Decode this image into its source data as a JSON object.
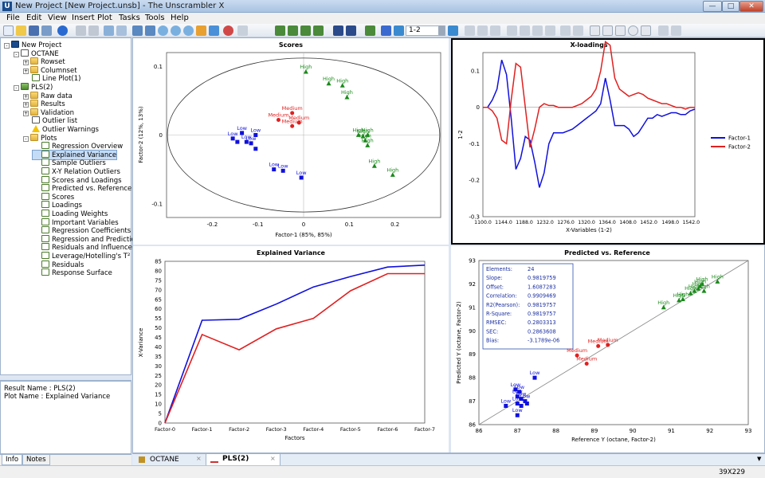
{
  "window": {
    "title": "New Project [New Project.unsb] - The Unscrambler X",
    "app_icon_letter": "U"
  },
  "menu": [
    "File",
    "Edit",
    "View",
    "Insert",
    "Plot",
    "Tasks",
    "Tools",
    "Help"
  ],
  "toolbar": {
    "range_value": "1-2"
  },
  "tree": [
    {
      "label": "New Project",
      "level": 0,
      "icon": "project-icon",
      "exp": "-"
    },
    {
      "label": "OCTANE",
      "level": 1,
      "icon": "document-icon",
      "exp": "-"
    },
    {
      "label": "Rowset",
      "level": 2,
      "icon": "folder-icon",
      "exp": "+"
    },
    {
      "label": "Columnset",
      "level": 2,
      "icon": "folder-icon",
      "exp": "+"
    },
    {
      "label": "Line Plot(1)",
      "level": 2,
      "icon": "line-plot-icon",
      "exp": ""
    },
    {
      "label": "PLS(2)",
      "level": 1,
      "icon": "model-icon",
      "exp": "-"
    },
    {
      "label": "Raw data",
      "level": 2,
      "icon": "folder-icon",
      "exp": "+"
    },
    {
      "label": "Results",
      "level": 2,
      "icon": "folder-icon",
      "exp": "+"
    },
    {
      "label": "Validation",
      "level": 2,
      "icon": "folder-icon",
      "exp": "+"
    },
    {
      "label": "Outlier list",
      "level": 2,
      "icon": "list-icon",
      "exp": ""
    },
    {
      "label": "Outlier Warnings",
      "level": 2,
      "icon": "warning-icon",
      "exp": ""
    },
    {
      "label": "Plots",
      "level": 2,
      "icon": "folder-icon",
      "exp": "-"
    },
    {
      "label": "Regression Overview",
      "level": 3,
      "icon": "plot-icon",
      "exp": ""
    },
    {
      "label": "Explained Variance",
      "level": 3,
      "icon": "plot-icon",
      "exp": "",
      "selected": true
    },
    {
      "label": "Sample Outliers",
      "level": 3,
      "icon": "plot-icon",
      "exp": ""
    },
    {
      "label": "X-Y Relation Outliers",
      "level": 3,
      "icon": "plot-icon",
      "exp": ""
    },
    {
      "label": "Scores and Loadings",
      "level": 3,
      "icon": "plot-icon",
      "exp": ""
    },
    {
      "label": "Predicted vs. Reference",
      "level": 3,
      "icon": "plot-icon",
      "exp": ""
    },
    {
      "label": "Scores",
      "level": 3,
      "icon": "plot-icon",
      "exp": ""
    },
    {
      "label": "Loadings",
      "level": 3,
      "icon": "plot-icon",
      "exp": ""
    },
    {
      "label": "Loading Weights",
      "level": 3,
      "icon": "plot-icon",
      "exp": ""
    },
    {
      "label": "Important Variables",
      "level": 3,
      "icon": "plot-icon",
      "exp": ""
    },
    {
      "label": "Regression Coefficients",
      "level": 3,
      "icon": "plot-icon",
      "exp": ""
    },
    {
      "label": "Regression and Prediction",
      "level": 3,
      "icon": "plot-icon",
      "exp": ""
    },
    {
      "label": "Residuals and Influence",
      "level": 3,
      "icon": "plot-icon",
      "exp": ""
    },
    {
      "label": "Leverage/Hotelling's T²",
      "level": 3,
      "icon": "plot-icon",
      "exp": ""
    },
    {
      "label": "Residuals",
      "level": 3,
      "icon": "plot-icon",
      "exp": ""
    },
    {
      "label": "Response Surface",
      "level": 3,
      "icon": "plot-icon",
      "exp": ""
    }
  ],
  "info": {
    "result_name": "Result Name : PLS(2)",
    "plot_name": "Plot Name : Explained Variance"
  },
  "bottom_tabs": [
    "Info",
    "Notes"
  ],
  "doc_tabs": [
    "OCTANE",
    "PLS(2)"
  ],
  "status": {
    "coords": "39X229"
  },
  "colors": {
    "blue": "#1010dd",
    "red": "#e02020",
    "green": "#1a8a1a",
    "highlight": "#c5dcf6"
  },
  "chart_data": [
    {
      "type": "scatter",
      "title": "Scores",
      "xlabel": "Factor-1 (85%, 85%)",
      "ylabel": "Factor-2 (12%, 13%)",
      "xlim": [
        -0.3,
        0.3
      ],
      "ylim": [
        -0.12,
        0.12
      ],
      "xticks": [
        -0.2,
        -0.1,
        0,
        0.1,
        0.2
      ],
      "yticks": [
        -0.1,
        0,
        0.1
      ],
      "series": [
        {
          "name": "Low",
          "color": "#1010dd",
          "marker": "square",
          "points": [
            [
              -0.155,
              -0.005,
              "Low"
            ],
            [
              -0.135,
              0.003,
              "Low"
            ],
            [
              -0.125,
              -0.01,
              "Low"
            ],
            [
              -0.105,
              0.0,
              "Low"
            ],
            [
              -0.115,
              -0.012,
              "Low"
            ],
            [
              -0.145,
              -0.01,
              ""
            ],
            [
              -0.105,
              -0.02,
              ""
            ],
            [
              -0.065,
              -0.05,
              "Low"
            ],
            [
              -0.045,
              -0.052,
              "Low"
            ],
            [
              -0.005,
              -0.062,
              "Low"
            ]
          ]
        },
        {
          "name": "Medium",
          "color": "#e02020",
          "marker": "circle",
          "points": [
            [
              -0.055,
              0.022,
              "Medium"
            ],
            [
              -0.025,
              0.032,
              "Medium"
            ],
            [
              -0.025,
              0.013,
              "Medium"
            ],
            [
              -0.01,
              0.018,
              "Medium"
            ]
          ]
        },
        {
          "name": "High",
          "color": "#1a8a1a",
          "marker": "triangle",
          "points": [
            [
              0.005,
              0.092,
              "High"
            ],
            [
              0.055,
              0.075,
              "High"
            ],
            [
              0.085,
              0.072,
              "High"
            ],
            [
              0.095,
              0.055,
              "High"
            ],
            [
              0.12,
              0.0,
              "High"
            ],
            [
              0.13,
              -0.002,
              "High"
            ],
            [
              0.14,
              0.0,
              "High"
            ],
            [
              0.135,
              -0.008,
              "High"
            ],
            [
              0.14,
              -0.015,
              "High"
            ],
            [
              0.155,
              -0.045,
              "High"
            ],
            [
              0.195,
              -0.058,
              "High"
            ]
          ]
        }
      ]
    },
    {
      "type": "line",
      "title": "X-loadings",
      "xlabel": "X-Variables (1-2)",
      "ylabel": "1-2",
      "xlim": [
        1100,
        1550
      ],
      "ylim": [
        -0.3,
        0.15
      ],
      "xticks": [
        1100.0,
        1144.0,
        1188.0,
        1232.0,
        1276.0,
        1320.0,
        1364.0,
        1408.0,
        1452.0,
        1498.0,
        1542.0
      ],
      "yticks": [
        -0.3,
        -0.2,
        -0.1,
        0,
        0.1
      ],
      "legend": "right",
      "series": [
        {
          "name": "Factor-1",
          "color": "#1010dd",
          "x": [
            1100,
            1110,
            1120,
            1130,
            1140,
            1150,
            1160,
            1170,
            1180,
            1190,
            1200,
            1210,
            1220,
            1230,
            1240,
            1250,
            1260,
            1270,
            1280,
            1290,
            1300,
            1310,
            1320,
            1330,
            1340,
            1350,
            1360,
            1370,
            1380,
            1390,
            1400,
            1410,
            1420,
            1430,
            1440,
            1450,
            1460,
            1470,
            1480,
            1490,
            1500,
            1510,
            1520,
            1530,
            1540,
            1550
          ],
          "y": [
            0.0,
            0.0,
            0.02,
            0.05,
            0.13,
            0.09,
            -0.03,
            -0.17,
            -0.14,
            -0.08,
            -0.09,
            -0.15,
            -0.22,
            -0.18,
            -0.1,
            -0.07,
            -0.07,
            -0.07,
            -0.065,
            -0.06,
            -0.05,
            -0.04,
            -0.03,
            -0.02,
            -0.01,
            0.01,
            0.08,
            0.02,
            -0.05,
            -0.05,
            -0.05,
            -0.06,
            -0.08,
            -0.07,
            -0.05,
            -0.03,
            -0.03,
            -0.02,
            -0.025,
            -0.02,
            -0.015,
            -0.015,
            -0.02,
            -0.02,
            -0.01,
            -0.005
          ]
        },
        {
          "name": "Factor-2",
          "color": "#e02020",
          "x": [
            1100,
            1110,
            1120,
            1130,
            1140,
            1150,
            1160,
            1170,
            1180,
            1190,
            1200,
            1210,
            1220,
            1230,
            1240,
            1250,
            1260,
            1270,
            1280,
            1290,
            1300,
            1310,
            1320,
            1330,
            1340,
            1350,
            1360,
            1370,
            1380,
            1390,
            1400,
            1410,
            1420,
            1430,
            1440,
            1450,
            1460,
            1470,
            1480,
            1490,
            1500,
            1510,
            1520,
            1530,
            1540,
            1550
          ],
          "y": [
            0.0,
            0.0,
            -0.01,
            -0.03,
            -0.09,
            -0.1,
            0.02,
            0.12,
            0.11,
            0.0,
            -0.11,
            -0.06,
            0.0,
            0.01,
            0.005,
            0.005,
            0.0,
            0.0,
            0.0,
            0.0,
            0.005,
            0.01,
            0.02,
            0.03,
            0.05,
            0.1,
            0.18,
            0.17,
            0.08,
            0.05,
            0.04,
            0.03,
            0.035,
            0.04,
            0.035,
            0.025,
            0.02,
            0.015,
            0.01,
            0.01,
            0.005,
            0.0,
            0.0,
            -0.005,
            0.0,
            0.0
          ]
        }
      ]
    },
    {
      "type": "line",
      "title": "Explained Variance",
      "xlabel": "Factors",
      "ylabel": "X-Variance",
      "categories": [
        "Factor-0",
        "Factor-1",
        "Factor-2",
        "Factor-3",
        "Factor-4",
        "Factor-5",
        "Factor-6",
        "Factor-7"
      ],
      "ylim": [
        0,
        85
      ],
      "yticks": [
        0,
        5,
        10,
        15,
        20,
        25,
        30,
        35,
        40,
        45,
        50,
        55,
        60,
        65,
        70,
        75,
        80,
        85
      ],
      "series": [
        {
          "color": "#1010dd",
          "values": [
            0,
            54,
            54.5,
            62.5,
            71.5,
            77,
            82,
            83
          ]
        },
        {
          "color": "#e02020",
          "values": [
            0,
            46.5,
            38.5,
            49.5,
            55,
            69.5,
            78.5,
            78.5
          ]
        }
      ]
    },
    {
      "type": "scatter",
      "title": "Predicted vs. Reference",
      "xlabel": "Reference Y (octane, Factor-2)",
      "ylabel": "Predicted Y (octane, Factor-2)",
      "xlim": [
        86,
        93
      ],
      "ylim": [
        86,
        93
      ],
      "xticks": [
        86,
        87,
        88,
        89,
        90,
        91,
        92,
        93
      ],
      "yticks": [
        86,
        87,
        88,
        89,
        90,
        91,
        92,
        93
      ],
      "stats": [
        [
          "Elements:",
          "24"
        ],
        [
          "Slope:",
          "0.9819759"
        ],
        [
          "Offset:",
          "1.6087283"
        ],
        [
          "Correlation:",
          "0.9909469"
        ],
        [
          "R2(Pearson):",
          "0.9819757"
        ],
        [
          "R-Square:",
          "0.9819757"
        ],
        [
          "RMSEC:",
          "0.2803313"
        ],
        [
          "SEC:",
          "0.2863608"
        ],
        [
          "Bias:",
          "-3.1789e-06"
        ]
      ],
      "series": [
        {
          "name": "Low",
          "color": "#1010dd",
          "marker": "square",
          "points": [
            [
              86.7,
              86.8,
              "Low"
            ],
            [
              86.95,
              87.5,
              "Low"
            ],
            [
              87.0,
              87.2,
              "Low"
            ],
            [
              87.0,
              86.9,
              "Low"
            ],
            [
              87.05,
              87.4,
              "Low"
            ],
            [
              87.1,
              87.1,
              "Low"
            ],
            [
              87.1,
              86.8,
              ""
            ],
            [
              87.2,
              87.0,
              "Low"
            ],
            [
              87.25,
              86.9,
              ""
            ],
            [
              87.0,
              86.4,
              "Low"
            ],
            [
              87.45,
              88.0,
              "Low"
            ]
          ]
        },
        {
          "name": "Medium",
          "color": "#e02020",
          "marker": "circle",
          "points": [
            [
              88.55,
              88.95,
              "Medium"
            ],
            [
              88.8,
              88.6,
              "Medium"
            ],
            [
              89.1,
              89.35,
              "Medium"
            ],
            [
              89.35,
              89.4,
              "Medium"
            ]
          ]
        },
        {
          "name": "High",
          "color": "#1a8a1a",
          "marker": "triangle",
          "points": [
            [
              90.8,
              91.0,
              "High"
            ],
            [
              91.2,
              91.3,
              "High"
            ],
            [
              91.3,
              91.35,
              "High"
            ],
            [
              91.5,
              91.6,
              "High"
            ],
            [
              91.6,
              91.7,
              "High"
            ],
            [
              91.7,
              91.8,
              "High"
            ],
            [
              91.75,
              91.9,
              "High"
            ],
            [
              91.8,
              92.0,
              "High"
            ],
            [
              91.85,
              91.7,
              "High"
            ],
            [
              92.2,
              92.1,
              "High"
            ]
          ]
        }
      ]
    }
  ]
}
